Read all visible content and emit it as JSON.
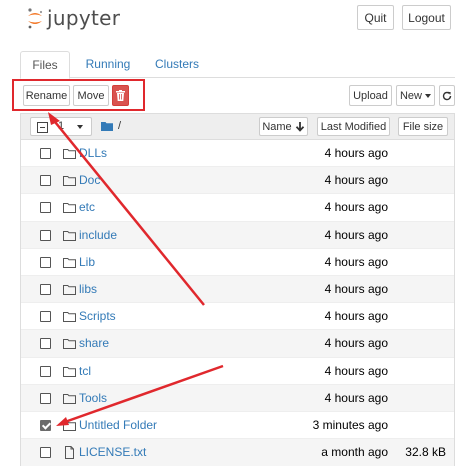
{
  "header": {
    "logo_text": "jupyter",
    "quit_label": "Quit",
    "logout_label": "Logout"
  },
  "tabs": [
    {
      "label": "Files",
      "active": true
    },
    {
      "label": "Running",
      "active": false
    },
    {
      "label": "Clusters",
      "active": false
    }
  ],
  "toolbar": {
    "rename_label": "Rename",
    "move_label": "Move",
    "delete_icon": "trash-icon",
    "upload_label": "Upload",
    "new_label": "New",
    "refresh_icon": "refresh-icon"
  },
  "list_header": {
    "selected_count": "1",
    "breadcrumb_sep": "/",
    "name_label": "Name",
    "last_modified_label": "Last Modified",
    "file_size_label": "File size"
  },
  "rows": [
    {
      "name": "DLLs",
      "modified": "4 hours ago",
      "size": "",
      "type": "folder",
      "checked": false
    },
    {
      "name": "Doc",
      "modified": "4 hours ago",
      "size": "",
      "type": "folder",
      "checked": false
    },
    {
      "name": "etc",
      "modified": "4 hours ago",
      "size": "",
      "type": "folder",
      "checked": false
    },
    {
      "name": "include",
      "modified": "4 hours ago",
      "size": "",
      "type": "folder",
      "checked": false
    },
    {
      "name": "Lib",
      "modified": "4 hours ago",
      "size": "",
      "type": "folder",
      "checked": false
    },
    {
      "name": "libs",
      "modified": "4 hours ago",
      "size": "",
      "type": "folder",
      "checked": false
    },
    {
      "name": "Scripts",
      "modified": "4 hours ago",
      "size": "",
      "type": "folder",
      "checked": false
    },
    {
      "name": "share",
      "modified": "4 hours ago",
      "size": "",
      "type": "folder",
      "checked": false
    },
    {
      "name": "tcl",
      "modified": "4 hours ago",
      "size": "",
      "type": "folder",
      "checked": false
    },
    {
      "name": "Tools",
      "modified": "4 hours ago",
      "size": "",
      "type": "folder",
      "checked": false
    },
    {
      "name": "Untitled Folder",
      "modified": "3 minutes ago",
      "size": "",
      "type": "folder",
      "checked": true
    },
    {
      "name": "LICENSE.txt",
      "modified": "a month ago",
      "size": "32.8 kB",
      "type": "file",
      "checked": false
    }
  ],
  "colors": {
    "link": "#337ab7",
    "annotation_red": "#e0282d",
    "delete_red": "#d9534f",
    "logo_orange": "#f37726"
  }
}
